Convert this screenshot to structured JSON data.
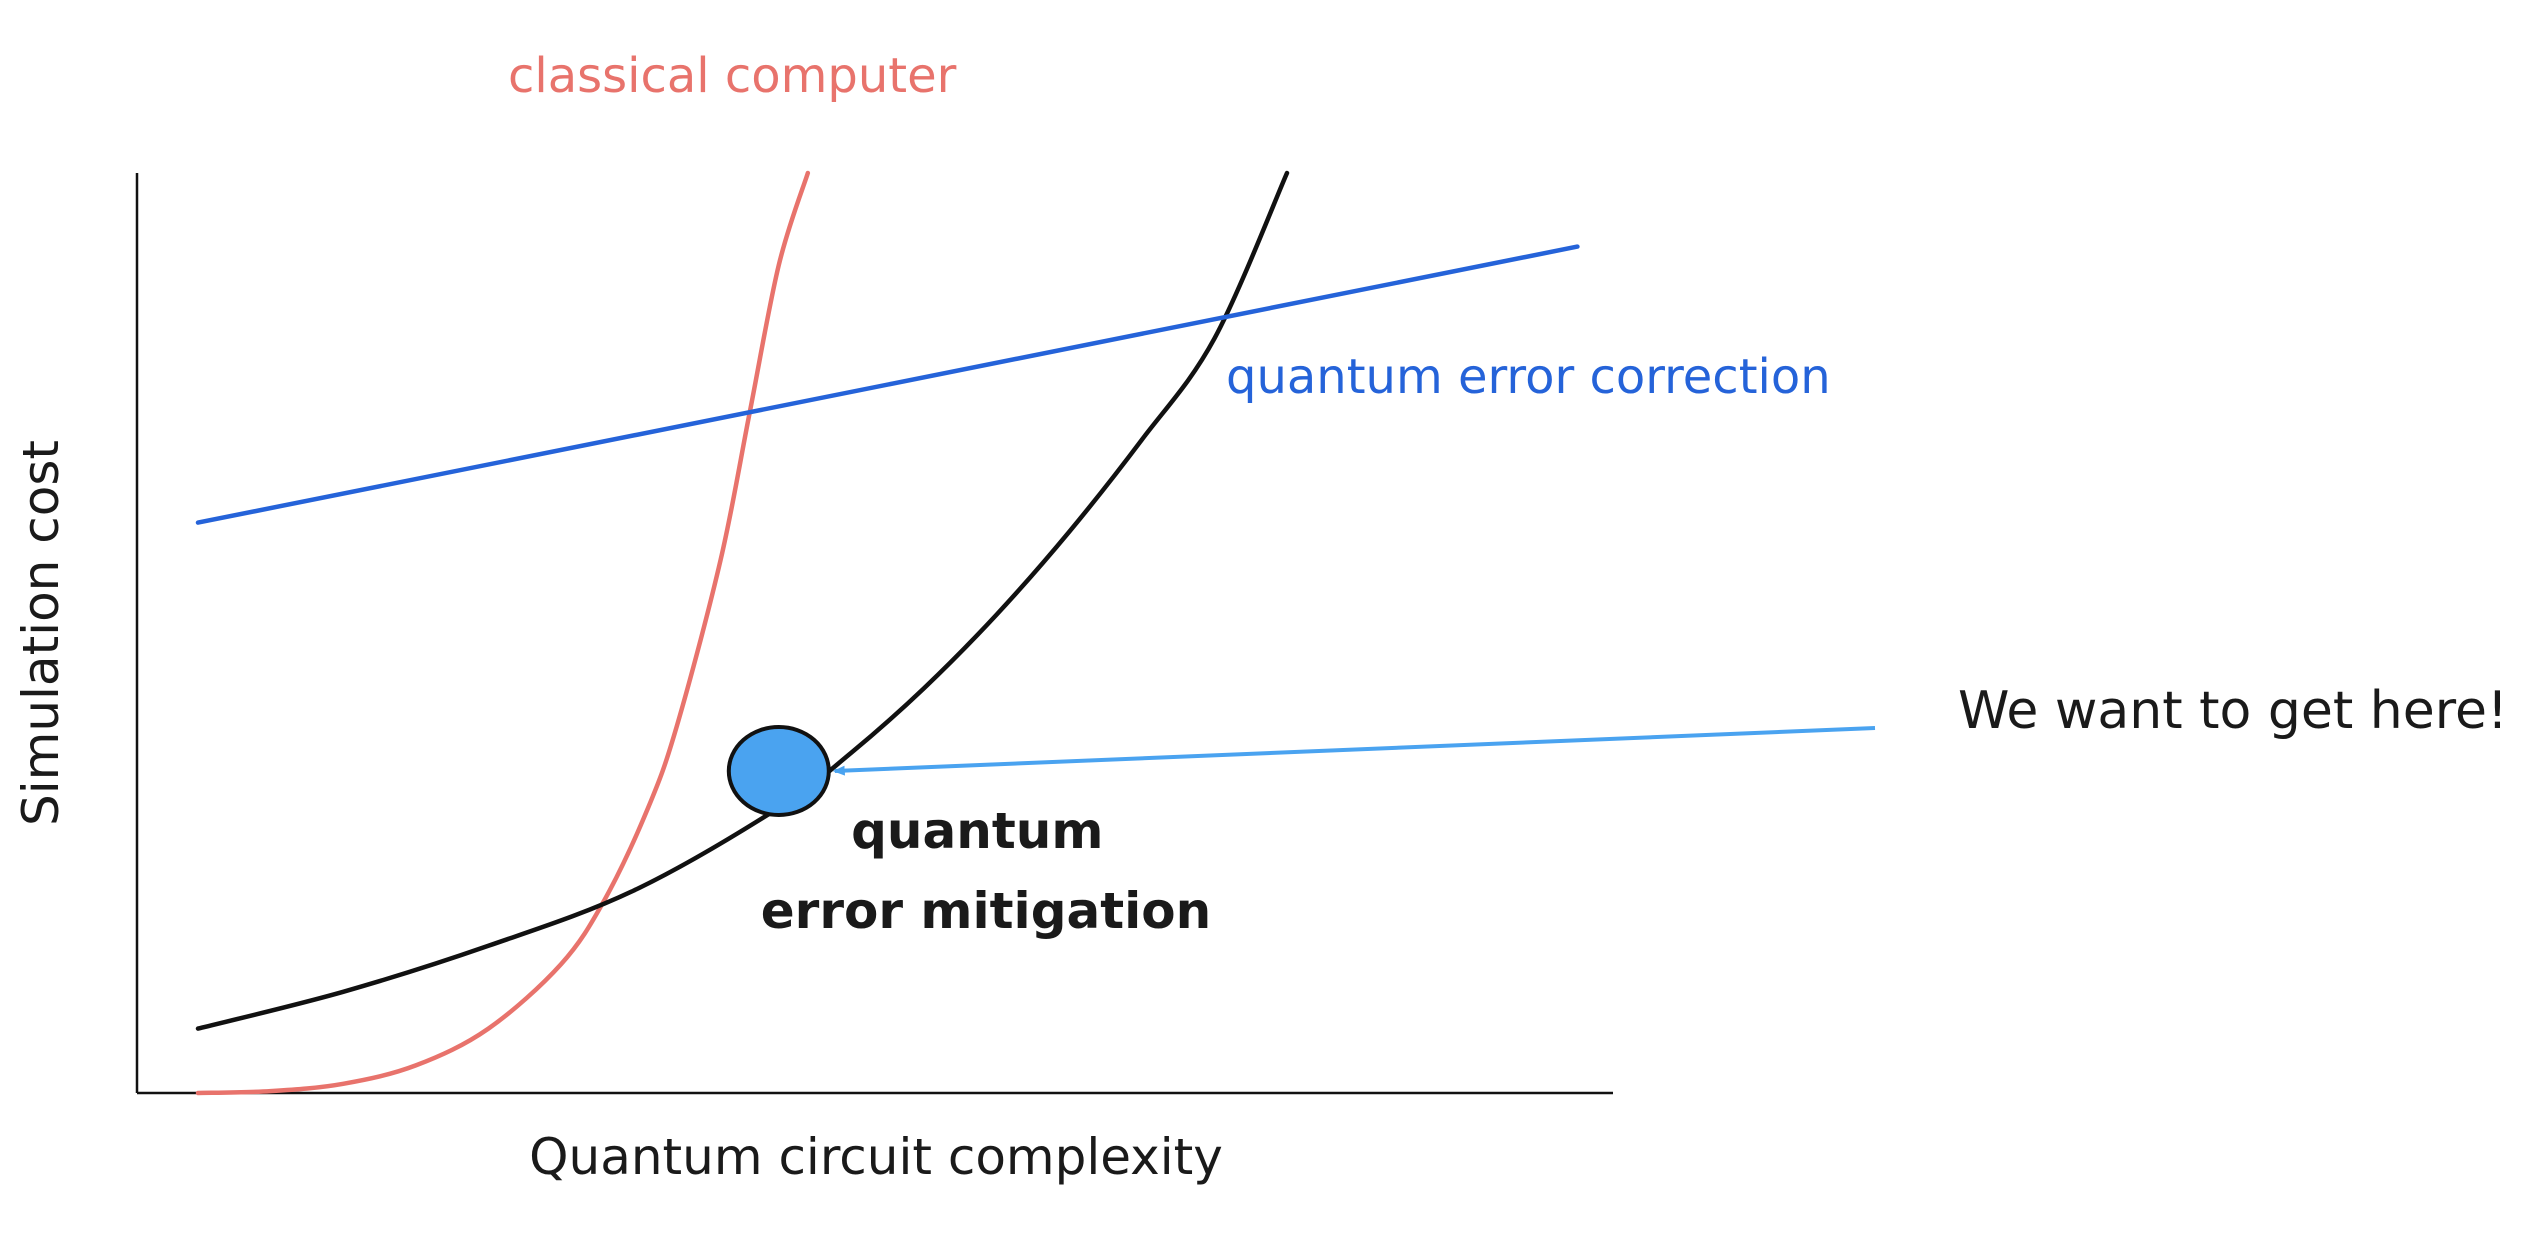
{
  "chart_data": {
    "type": "line",
    "xlabel": "Quantum circuit complexity",
    "ylabel": "Simulation cost",
    "ticks_shown": false,
    "grid": false,
    "series": [
      {
        "name": "classical computer",
        "color": "#e8736c",
        "shape": "exponential (steep)",
        "x": [
          0.0,
          0.05,
          0.1,
          0.15,
          0.2,
          0.25,
          0.28,
          0.31,
          0.33,
          0.36,
          0.38,
          0.4,
          0.42
        ],
        "y": [
          0.0,
          0.002,
          0.01,
          0.03,
          0.07,
          0.14,
          0.21,
          0.31,
          0.4,
          0.58,
          0.74,
          0.9,
          1.0
        ]
      },
      {
        "name": "quantum error mitigation",
        "color": "#111111",
        "shape": "exponential (moderate)",
        "x": [
          0.0,
          0.1,
          0.2,
          0.3,
          0.4,
          0.45,
          0.5,
          0.55,
          0.6,
          0.65,
          0.7,
          0.75
        ],
        "y": [
          0.07,
          0.11,
          0.16,
          0.22,
          0.31,
          0.37,
          0.44,
          0.52,
          0.61,
          0.71,
          0.82,
          1.0
        ]
      },
      {
        "name": "quantum error correction",
        "color": "#2563d9",
        "shape": "linear",
        "x": [
          0.0,
          0.95
        ],
        "y": [
          0.62,
          0.92
        ]
      }
    ],
    "highlight_point": {
      "x": 0.4,
      "y": 0.35,
      "color": "#4aa3f0",
      "series": "quantum error mitigation"
    },
    "annotation": {
      "text": "We want to get here!",
      "arrow_color": "#4aa3f0"
    },
    "xlim": [
      0,
      1
    ],
    "ylim": [
      0,
      1
    ]
  }
}
